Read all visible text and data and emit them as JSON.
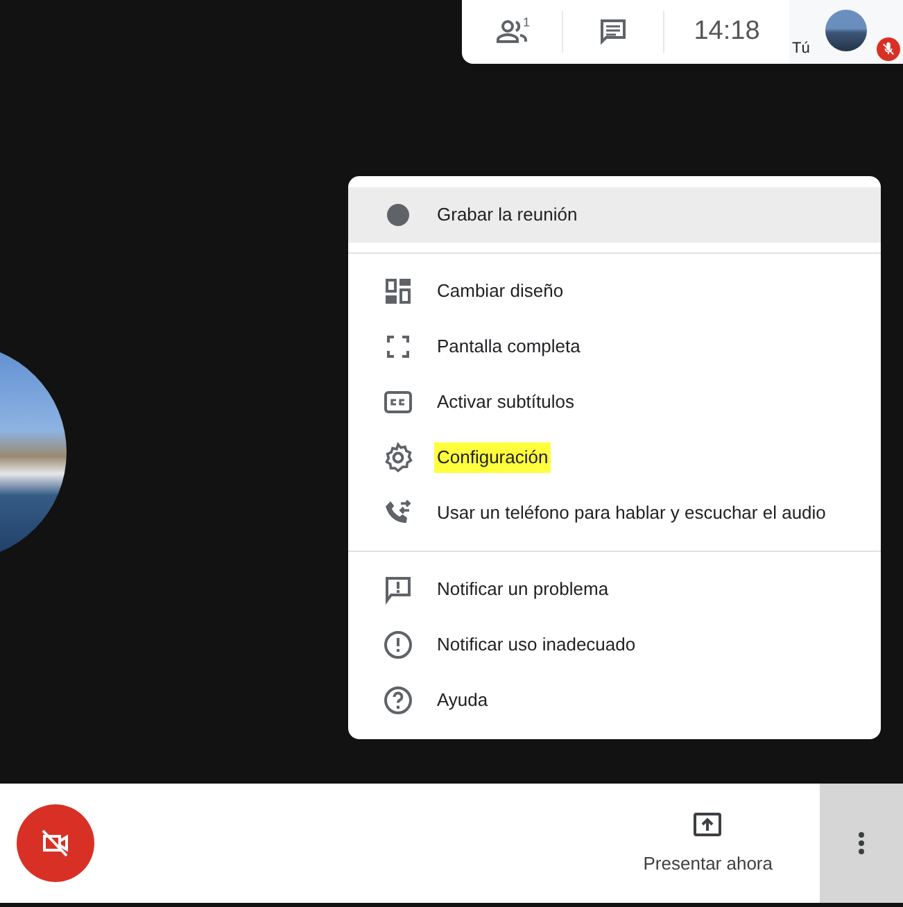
{
  "top_bar": {
    "participants_count": "1",
    "time": "14:18",
    "self_label": "Tú",
    "self_muted": true
  },
  "menu": {
    "groups": [
      {
        "items": [
          {
            "kind": "record",
            "label": "Grabar la reunión",
            "highlighted": true,
            "marked": false
          }
        ]
      },
      {
        "items": [
          {
            "kind": "layout",
            "label": "Cambiar diseño",
            "highlighted": false,
            "marked": false
          },
          {
            "kind": "fullscreen",
            "label": "Pantalla completa",
            "highlighted": false,
            "marked": false
          },
          {
            "kind": "captions",
            "label": "Activar subtítulos",
            "highlighted": false,
            "marked": false
          },
          {
            "kind": "settings",
            "label": "Configuración",
            "highlighted": false,
            "marked": true
          },
          {
            "kind": "phone",
            "label": "Usar un teléfono para hablar y escuchar el audio",
            "highlighted": false,
            "marked": false
          }
        ]
      },
      {
        "items": [
          {
            "kind": "report",
            "label": "Notificar un problema",
            "highlighted": false,
            "marked": false
          },
          {
            "kind": "abuse",
            "label": "Notificar uso inadecuado",
            "highlighted": false,
            "marked": false
          },
          {
            "kind": "help",
            "label": "Ayuda",
            "highlighted": false,
            "marked": false
          }
        ]
      }
    ]
  },
  "bottom_bar": {
    "camera_off": true,
    "present_label": "Presentar ahora",
    "more_active": true
  }
}
